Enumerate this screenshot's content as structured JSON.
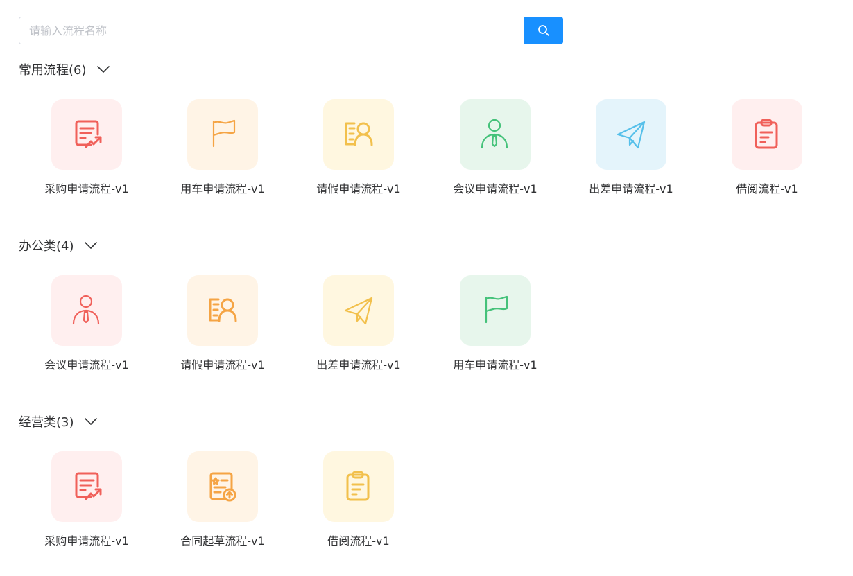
{
  "search": {
    "placeholder": "请输入流程名称",
    "value": ""
  },
  "groups": [
    {
      "title": "常用流程(6)",
      "items": [
        {
          "label": "采购申请流程-v1",
          "icon": "purchase-doc-icon",
          "color": "#f0605a",
          "bg": "#ffefef"
        },
        {
          "label": "用车申请流程-v1",
          "icon": "flag-icon",
          "color": "#f5a444",
          "bg": "#fff4e6"
        },
        {
          "label": "请假申请流程-v1",
          "icon": "id-card-person-icon",
          "color": "#f2c04c",
          "bg": "#fff7e0"
        },
        {
          "label": "会议申请流程-v1",
          "icon": "person-tie-icon",
          "color": "#45c27a",
          "bg": "#e7f6ec"
        },
        {
          "label": "出差申请流程-v1",
          "icon": "paper-plane-icon",
          "color": "#56c0ea",
          "bg": "#e4f4fb"
        },
        {
          "label": "借阅流程-v1",
          "icon": "clipboard-icon",
          "color": "#f0605a",
          "bg": "#ffefef"
        }
      ]
    },
    {
      "title": "办公类(4)",
      "items": [
        {
          "label": "会议申请流程-v1",
          "icon": "person-tie-icon",
          "color": "#f0605a",
          "bg": "#ffefef"
        },
        {
          "label": "请假申请流程-v1",
          "icon": "id-card-person-icon",
          "color": "#f5a444",
          "bg": "#fff4e6"
        },
        {
          "label": "出差申请流程-v1",
          "icon": "paper-plane-icon",
          "color": "#f2c04c",
          "bg": "#fff7e0"
        },
        {
          "label": "用车申请流程-v1",
          "icon": "flag-icon",
          "color": "#45c27a",
          "bg": "#e7f6ec"
        }
      ]
    },
    {
      "title": "经营类(3)",
      "items": [
        {
          "label": "采购申请流程-v1",
          "icon": "purchase-doc-icon",
          "color": "#f0605a",
          "bg": "#ffefef"
        },
        {
          "label": "合同起草流程-v1",
          "icon": "contract-upload-icon",
          "color": "#f5a444",
          "bg": "#fff4e6"
        },
        {
          "label": "借阅流程-v1",
          "icon": "clipboard-icon",
          "color": "#f2c04c",
          "bg": "#fff7e0"
        }
      ]
    }
  ]
}
